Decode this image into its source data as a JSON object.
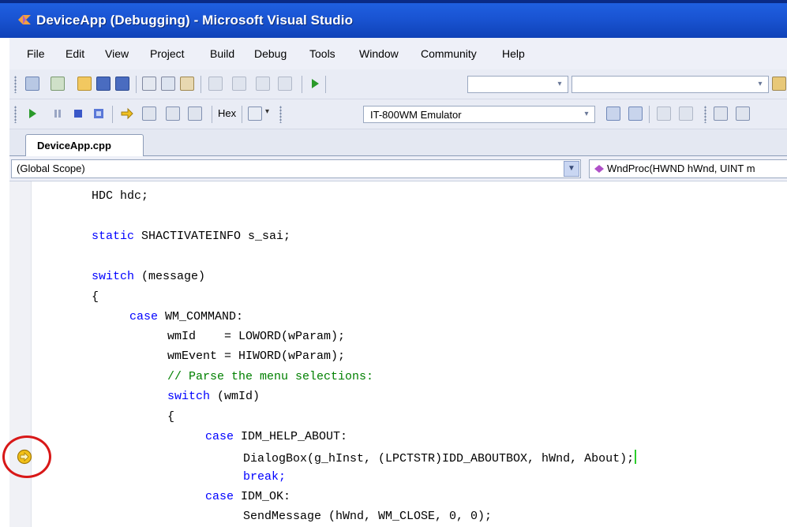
{
  "window": {
    "title": "DeviceApp (Debugging) - Microsoft Visual Studio"
  },
  "menu": [
    "File",
    "Edit",
    "View",
    "Project",
    "Build",
    "Debug",
    "Tools",
    "Window",
    "Community",
    "Help"
  ],
  "toolbar2": {
    "hex_label": "Hex",
    "device_combo": "IT-800WM Emulator"
  },
  "tabs": [
    {
      "label": "DeviceApp.cpp"
    }
  ],
  "scope": {
    "left": "(Global Scope)",
    "right": "WndProc(HWND hWnd, UINT m"
  },
  "code": [
    "HDC hdc;",
    "static SHACTIVATEINFO s_sai;",
    "switch (message)",
    "{",
    "case WM_COMMAND:",
    "wmId    = LOWORD(wParam);",
    "wmEvent = HIWORD(wParam);",
    "// Parse the menu selections:",
    "switch (wmId)",
    "{",
    "case IDM_HELP_ABOUT:",
    "DialogBox(g_hInst, (LPCTSTR)IDD_ABOUTBOX, hWnd, About);",
    "break;",
    "case IDM_OK:",
    "SendMessage (hWnd, WM_CLOSE, 0, 0);"
  ],
  "colors": {
    "keyword": "#0000ff",
    "comment": "#008000",
    "titlebar": "#1a55d4",
    "highlight_circle": "#d81818"
  },
  "icons": [
    "app-icon",
    "current-statement-arrow-icon",
    "method-icon"
  ]
}
